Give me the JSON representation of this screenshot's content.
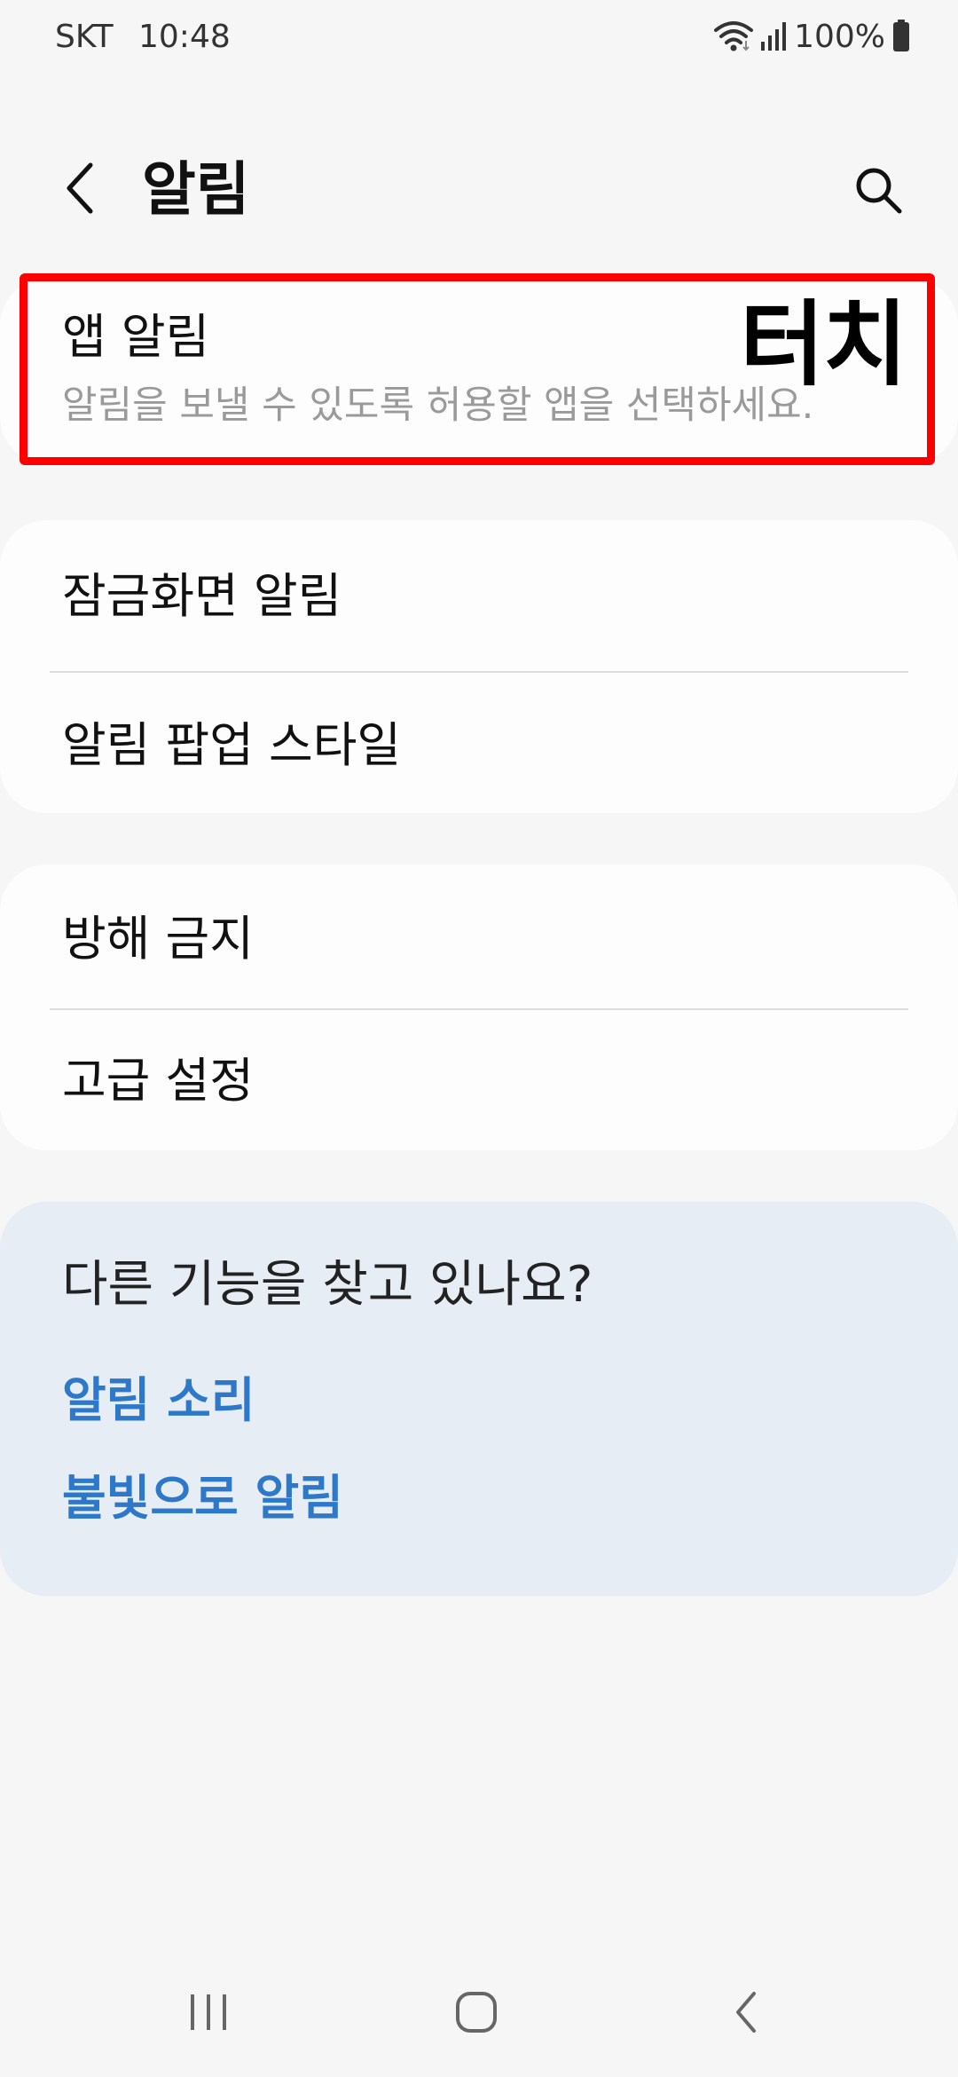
{
  "status_bar": {
    "carrier": "SKT",
    "time": "10:48",
    "battery": "100%"
  },
  "header": {
    "title": "알림",
    "back_icon": "chevron-left-icon",
    "search_icon": "search-icon"
  },
  "app_notifications": {
    "title": "앱 알림",
    "subtitle": "알림을 보낼 수 있도록 허용할 앱을 선택하세요."
  },
  "annotation": {
    "label": "터치",
    "color": "#ff0000"
  },
  "group1": {
    "items": [
      {
        "label": "잠금화면 알림"
      },
      {
        "label": "알림 팝업 스타일"
      }
    ]
  },
  "group2": {
    "items": [
      {
        "label": "방해 금지"
      },
      {
        "label": "고급 설정"
      }
    ]
  },
  "suggestions": {
    "title": "다른 기능을 찾고 있나요?",
    "links": [
      {
        "label": "알림 소리"
      },
      {
        "label": "불빛으로 알림"
      }
    ],
    "link_color": "#2e78c9",
    "background": "#e7edf5"
  },
  "nav_bar": {
    "recents_icon": "recents-icon",
    "home_icon": "home-icon",
    "back_icon": "back-icon"
  }
}
